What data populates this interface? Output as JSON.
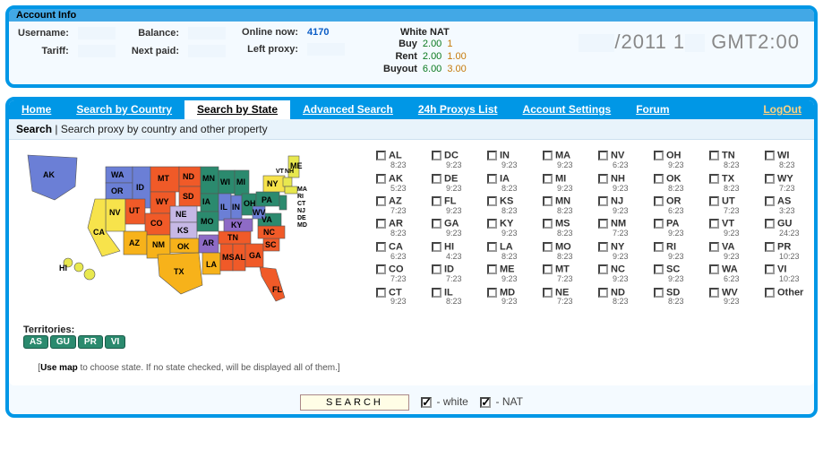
{
  "account": {
    "title": "Account Info",
    "labels": {
      "username": "Username:",
      "balance": "Balance:",
      "tariff": "Tariff:",
      "next_paid": "Next paid:",
      "online_now": "Online now:",
      "left_proxy": "Left proxy:"
    },
    "online_now": "4170",
    "nat": {
      "title": "White NAT",
      "buy_label": "Buy",
      "rent_label": "Rent",
      "buyout_label": "Buyout",
      "buy_w": "2.00",
      "buy_n": "1",
      "rent_w": "2.00",
      "rent_n": "1.00",
      "buyout_w": "6.00",
      "buyout_n": "3.00"
    },
    "date_year": "/2011 1",
    "date_tz": "GMT2:00"
  },
  "nav": {
    "home": "Home",
    "search_country": "Search by Country",
    "search_state": "Search by State",
    "advanced": "Advanced Search",
    "list24": "24h Proxys List",
    "settings": "Account Settings",
    "forum": "Forum",
    "logout": "LogOut"
  },
  "subhead": {
    "title": "Search",
    "desc": "Search proxy by country and other property"
  },
  "territories": {
    "label": "Territories:",
    "items": [
      "AS",
      "GU",
      "PR",
      "VI"
    ]
  },
  "map_tip_bold": "Use map",
  "map_tip_rest": " to choose state. If no state checked, will be displayed all of them.",
  "map_labels": {
    "AK": "AK",
    "WA": "WA",
    "OR": "OR",
    "ID": "ID",
    "MT": "MT",
    "ND": "ND",
    "SD": "SD",
    "MN": "MN",
    "WI": "WI",
    "MI": "MI",
    "NV": "NV",
    "CA": "CA",
    "UT": "UT",
    "WY": "WY",
    "CO": "CO",
    "NE": "NE",
    "IA": "IA",
    "IL": "IL",
    "IN": "IN",
    "OH": "OH",
    "AZ": "AZ",
    "NM": "NM",
    "KS": "KS",
    "MO": "MO",
    "OK": "OK",
    "AR": "AR",
    "TX": "TX",
    "LA": "LA",
    "MS": "MS",
    "AL": "AL",
    "TN": "TN",
    "KY": "KY",
    "GA": "GA",
    "FL": "FL",
    "SC": "SC",
    "NC": "NC",
    "VA": "VA",
    "WV": "WV",
    "PA": "PA",
    "NY": "NY",
    "ME": "ME",
    "HI": "HI",
    "NH": "NH",
    "VT": "VT",
    "MA": "MA",
    "RI": "RI",
    "CT": "CT",
    "NJ": "NJ",
    "DE": "DE",
    "MD": "MD"
  },
  "states": [
    {
      "abbr": "AL",
      "time": "8:23"
    },
    {
      "abbr": "DC",
      "time": "9:23"
    },
    {
      "abbr": "IN",
      "time": "9:23"
    },
    {
      "abbr": "MA",
      "time": "9:23"
    },
    {
      "abbr": "NV",
      "time": "6:23"
    },
    {
      "abbr": "OH",
      "time": "9:23"
    },
    {
      "abbr": "TN",
      "time": "8:23"
    },
    {
      "abbr": "WI",
      "time": "8:23"
    },
    {
      "abbr": "AK",
      "time": "5:23"
    },
    {
      "abbr": "DE",
      "time": "9:23"
    },
    {
      "abbr": "IA",
      "time": "8:23"
    },
    {
      "abbr": "MI",
      "time": "9:23"
    },
    {
      "abbr": "NH",
      "time": "9:23"
    },
    {
      "abbr": "OK",
      "time": "8:23"
    },
    {
      "abbr": "TX",
      "time": "8:23"
    },
    {
      "abbr": "WY",
      "time": "7:23"
    },
    {
      "abbr": "AZ",
      "time": "7:23"
    },
    {
      "abbr": "FL",
      "time": "9:23"
    },
    {
      "abbr": "KS",
      "time": "8:23"
    },
    {
      "abbr": "MN",
      "time": "8:23"
    },
    {
      "abbr": "NJ",
      "time": "9:23"
    },
    {
      "abbr": "OR",
      "time": "6:23"
    },
    {
      "abbr": "UT",
      "time": "7:23"
    },
    {
      "abbr": "AS",
      "time": "3:23"
    },
    {
      "abbr": "AR",
      "time": "8:23"
    },
    {
      "abbr": "GA",
      "time": "9:23"
    },
    {
      "abbr": "KY",
      "time": "9:23"
    },
    {
      "abbr": "MS",
      "time": "8:23"
    },
    {
      "abbr": "NM",
      "time": "7:23"
    },
    {
      "abbr": "PA",
      "time": "9:23"
    },
    {
      "abbr": "VT",
      "time": "9:23"
    },
    {
      "abbr": "GU",
      "time": "24:23"
    },
    {
      "abbr": "CA",
      "time": "6:23"
    },
    {
      "abbr": "HI",
      "time": "4:23"
    },
    {
      "abbr": "LA",
      "time": "8:23"
    },
    {
      "abbr": "MO",
      "time": "8:23"
    },
    {
      "abbr": "NY",
      "time": "9:23"
    },
    {
      "abbr": "RI",
      "time": "9:23"
    },
    {
      "abbr": "VA",
      "time": "9:23"
    },
    {
      "abbr": "PR",
      "time": "10:23"
    },
    {
      "abbr": "CO",
      "time": "7:23"
    },
    {
      "abbr": "ID",
      "time": "7:23"
    },
    {
      "abbr": "ME",
      "time": "9:23"
    },
    {
      "abbr": "MT",
      "time": "7:23"
    },
    {
      "abbr": "NC",
      "time": "9:23"
    },
    {
      "abbr": "SC",
      "time": "9:23"
    },
    {
      "abbr": "WA",
      "time": "6:23"
    },
    {
      "abbr": "VI",
      "time": "10:23"
    },
    {
      "abbr": "CT",
      "time": "9:23"
    },
    {
      "abbr": "IL",
      "time": "8:23"
    },
    {
      "abbr": "MD",
      "time": "9:23"
    },
    {
      "abbr": "NE",
      "time": "7:23"
    },
    {
      "abbr": "ND",
      "time": "8:23"
    },
    {
      "abbr": "SD",
      "time": "8:23"
    },
    {
      "abbr": "WV",
      "time": "9:23"
    },
    {
      "abbr": "Other",
      "time": ""
    }
  ],
  "search": {
    "button": "SEARCH",
    "white_label": " - white",
    "nat_label": " - NAT"
  }
}
